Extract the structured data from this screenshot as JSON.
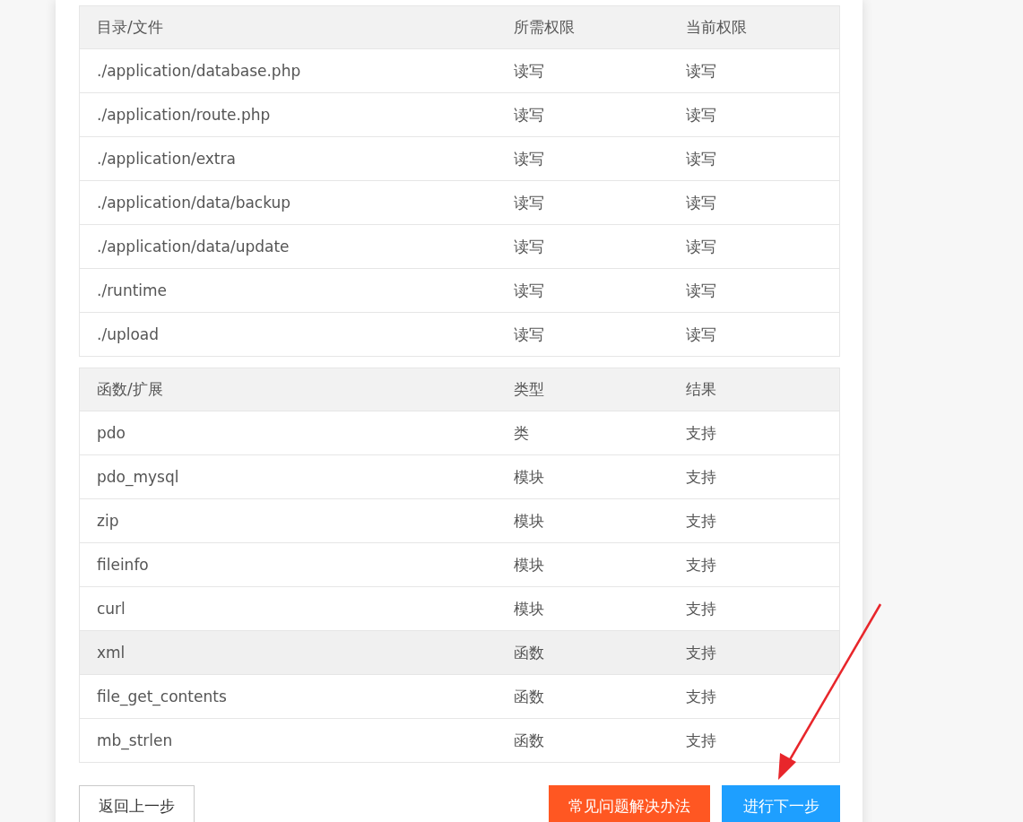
{
  "permissions_table": {
    "columns": [
      "目录/文件",
      "所需权限",
      "当前权限"
    ],
    "rows": [
      [
        "./application/database.php",
        "读写",
        "读写"
      ],
      [
        "./application/route.php",
        "读写",
        "读写"
      ],
      [
        "./application/extra",
        "读写",
        "读写"
      ],
      [
        "./application/data/backup",
        "读写",
        "读写"
      ],
      [
        "./application/data/update",
        "读写",
        "读写"
      ],
      [
        "./runtime",
        "读写",
        "读写"
      ],
      [
        "./upload",
        "读写",
        "读写"
      ]
    ]
  },
  "extensions_table": {
    "columns": [
      "函数/扩展",
      "类型",
      "结果"
    ],
    "rows": [
      {
        "cells": [
          "pdo",
          "类",
          "支持"
        ],
        "highlighted": false
      },
      {
        "cells": [
          "pdo_mysql",
          "模块",
          "支持"
        ],
        "highlighted": false
      },
      {
        "cells": [
          "zip",
          "模块",
          "支持"
        ],
        "highlighted": false
      },
      {
        "cells": [
          "fileinfo",
          "模块",
          "支持"
        ],
        "highlighted": false
      },
      {
        "cells": [
          "curl",
          "模块",
          "支持"
        ],
        "highlighted": false
      },
      {
        "cells": [
          "xml",
          "函数",
          "支持"
        ],
        "highlighted": true
      },
      {
        "cells": [
          "file_get_contents",
          "函数",
          "支持"
        ],
        "highlighted": false
      },
      {
        "cells": [
          "mb_strlen",
          "函数",
          "支持"
        ],
        "highlighted": false
      }
    ]
  },
  "buttons": [
    {
      "label": "返回上一步",
      "kind": "back"
    },
    {
      "label": "常见问题解决办法",
      "kind": "help"
    },
    {
      "label": "进行下一步",
      "kind": "next"
    }
  ]
}
